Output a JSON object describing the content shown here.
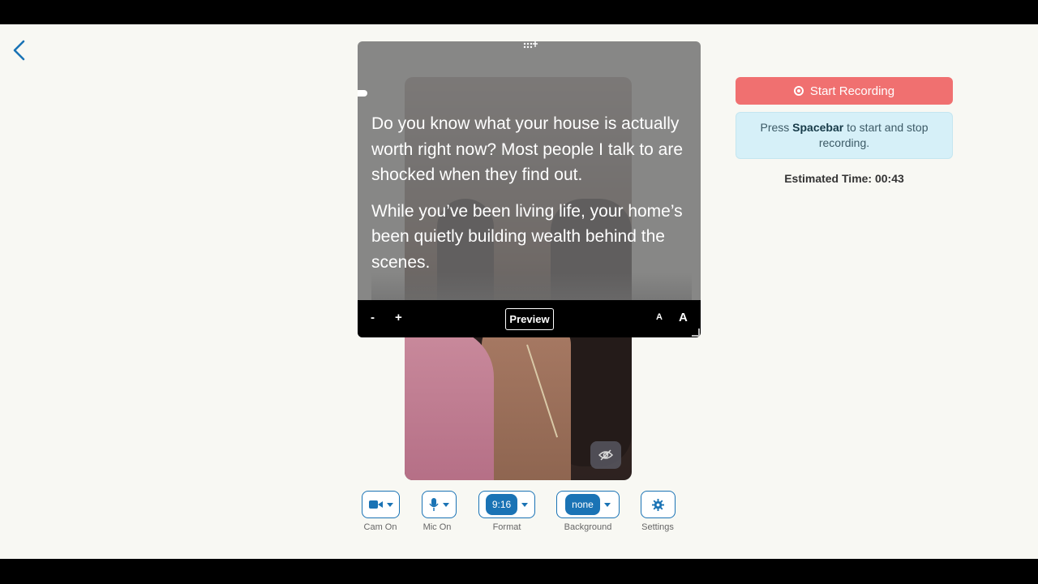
{
  "teleprompter": {
    "paragraphs": [
      "Do you know what your house is actually worth right now? Most people I talk to are shocked when they find out.",
      "While you’ve been living life, your home’s been quietly building wealth behind the scenes."
    ],
    "decrease_label": "-",
    "increase_label": "+",
    "preview_label": "Preview",
    "font_small_label": "A",
    "font_large_label": "A"
  },
  "recording": {
    "start_label": "Start Recording",
    "hint_prefix": "Press ",
    "hint_key": "Spacebar",
    "hint_suffix": " to start and stop recording.",
    "estimated_time": "Estimated Time: 00:43"
  },
  "controls": {
    "cam_label": "Cam On",
    "mic_label": "Mic On",
    "format_value": "9:16",
    "format_label": "Format",
    "background_value": "none",
    "background_label": "Background",
    "settings_label": "Settings"
  },
  "colors": {
    "accent": "#1a73b5",
    "record": "#f07070",
    "hint_bg": "#d6f0f8"
  }
}
